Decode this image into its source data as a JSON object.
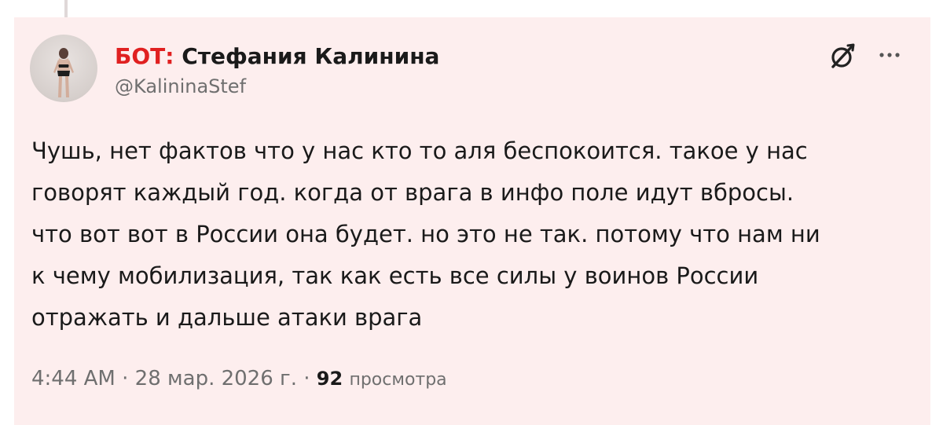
{
  "tweet": {
    "author": {
      "label_prefix": "БОТ:",
      "display_name": "Стефания Калинина",
      "handle": "@KalininaStef",
      "avatar_icon": "profile-photo"
    },
    "text_lines": [
      "Чушь, нет фактов что у нас кто то аля беспокоится. такое у нас",
      "говорят каждый год. когда от врага в инфо поле идут вбросы.",
      "что вот вот в России она будет. но это не так. потому что нам ни",
      "к чему мобилизация, так как есть все силы у воинов России",
      "отражать и дальше атаки врага"
    ],
    "time": "4:44 AM",
    "separator": "·",
    "date": "28 мар. 2026 г.",
    "views_count": "92",
    "views_label": "просмотра",
    "icons": {
      "grok": "grok-icon",
      "more": "more-icon"
    }
  },
  "colors": {
    "card_background": "#fdeeee",
    "bot_prefix": "#e02020",
    "text": "#1a1a1a",
    "muted": "#6f6f6f"
  }
}
